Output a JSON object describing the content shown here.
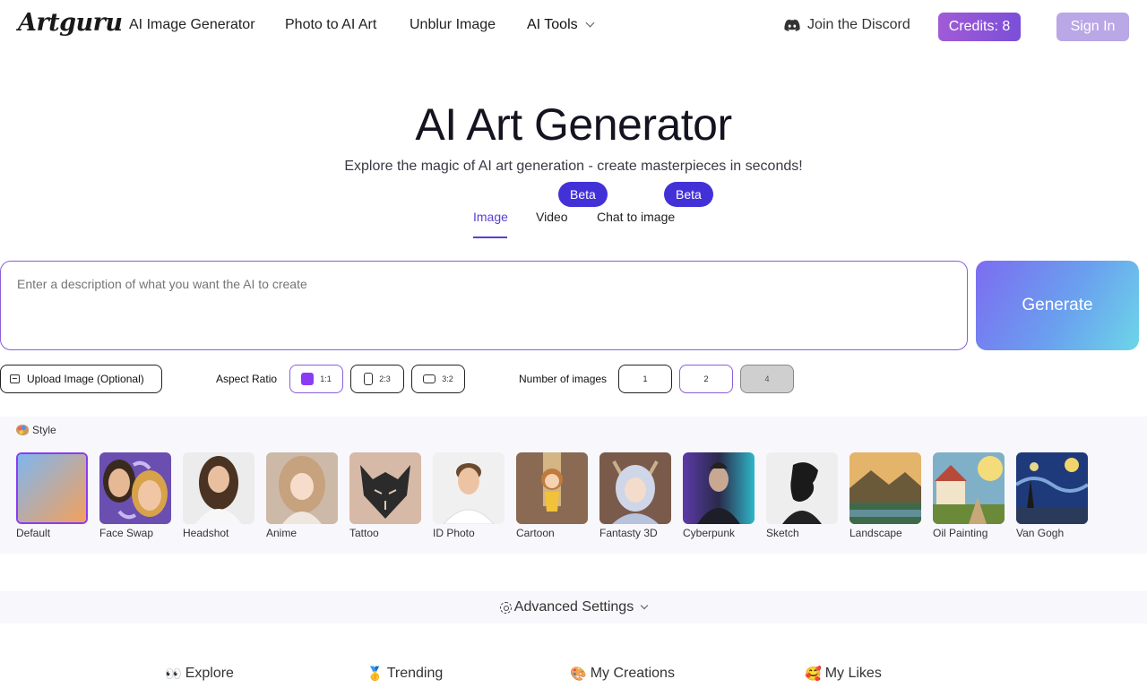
{
  "header": {
    "logo": "Artguru",
    "nav": [
      "AI Image Generator",
      "Photo to AI Art",
      "Unblur Image",
      "AI Tools"
    ],
    "discord": "Join the Discord",
    "credits": "Credits: 8",
    "sign_in": "Sign In"
  },
  "hero": {
    "title": "AI Art Generator",
    "subtitle": "Explore the magic of AI art generation - create masterpieces in seconds!"
  },
  "mode_tabs": {
    "image": "Image",
    "video": "Video",
    "chat": "Chat to image",
    "beta": "Beta",
    "active": "Image"
  },
  "prompt": {
    "placeholder": "Enter a description of what you want the AI to create",
    "value": ""
  },
  "generate_label": "Generate",
  "options": {
    "upload": "Upload Image (Optional)",
    "aspect_label": "Aspect Ratio",
    "ratios": [
      "1:1",
      "2:3",
      "3:2"
    ],
    "selected_ratio": "1:1",
    "count_label": "Number of images",
    "counts": [
      "1",
      "2",
      "4"
    ],
    "selected_count": "2",
    "disabled_count": "4"
  },
  "style": {
    "heading": "Style",
    "items": [
      "Default",
      "Face Swap",
      "Headshot",
      "Anime",
      "Tattoo",
      "ID Photo",
      "Cartoon",
      "Fantasty 3D",
      "Cyberpunk",
      "Sketch",
      "Landscape",
      "Oil Painting",
      "Van Gogh"
    ],
    "selected": "Default"
  },
  "advanced": {
    "label": "Advanced Settings"
  },
  "bottom_tabs": [
    {
      "emoji": "👀",
      "label": "Explore"
    },
    {
      "emoji": "🥇",
      "label": "Trending"
    },
    {
      "emoji": "🎨",
      "label": "My Creations"
    },
    {
      "emoji": "🥰",
      "label": "My Likes"
    }
  ],
  "colors": {
    "accent": "#5b3fd0",
    "beta_bg": "#4331d8",
    "credits_bg": "#8b54d6",
    "signin_bg": "#b9a7e6",
    "selected_border": "#8b3cf3"
  }
}
